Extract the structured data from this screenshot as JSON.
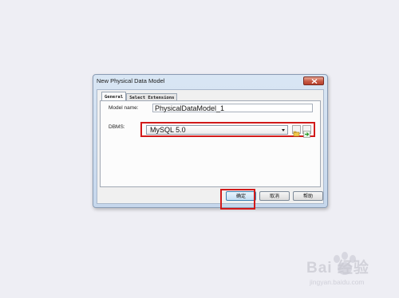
{
  "dialog": {
    "title": "New Physical Data Model"
  },
  "tabs": [
    {
      "label": "General",
      "active": true
    },
    {
      "label": "Select Extensions",
      "active": false
    }
  ],
  "form": {
    "model_name_label": "Model name:",
    "model_name_value": "PhysicalDataModel_1",
    "dbms_label": "DBMS:",
    "dbms_value": "MySQL 5.0"
  },
  "buttons": {
    "ok": "确定",
    "cancel": "取消",
    "help": "帮助"
  },
  "watermark": {
    "brand": "Bai 经验",
    "url": "jingyan.baidu.com"
  },
  "colors": {
    "highlight_red": "#d21a1a",
    "titlebar": "#c6d7ec",
    "close_red": "#c75a45"
  }
}
